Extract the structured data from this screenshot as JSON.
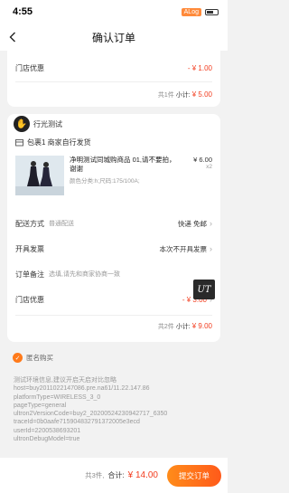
{
  "status": {
    "time": "4:55",
    "badge": "ALog"
  },
  "nav": {
    "title": "确认订单"
  },
  "card1": {
    "discount_label": "门店优惠",
    "discount_value": "- ¥ 1.00",
    "count_text": "共1件",
    "subtotal_label": "小计:",
    "subtotal_value": "¥ 5.00"
  },
  "card2": {
    "shop_name": "行光测试",
    "package_text": "包裹1 商家自行发货",
    "item": {
      "title": "净明测试同城购商品 01,请不要拍，谢谢",
      "sku": "颜色分类:h;尺码:175/100A;",
      "price": "¥ 6.00",
      "qty": "x2"
    },
    "delivery": {
      "label": "配送方式",
      "sub": "普通配送",
      "value": "快递 免邮"
    },
    "invoice": {
      "label": "开具发票",
      "value": "本次不开具发票"
    },
    "note": {
      "label": "订单备注",
      "placeholder": "选填,请先和商家协商一致"
    },
    "discount": {
      "label": "门店优惠",
      "value": "- ¥ 3.00"
    },
    "count_text": "共2件",
    "subtotal_label": "小计:",
    "subtotal_value": "¥ 9.00",
    "ut_badge": "UT"
  },
  "anonymous": {
    "label": "匿名购买",
    "checked": true
  },
  "debug_lines": [
    "测试环境信息,建议开启天启对比忽略",
    "host=buy2011022147086.pre.na61/11.22.147.86",
    "platformType=WIRELESS_3_0",
    "pageType=general",
    "ultron2VersionCode=buy2_20200524230942717_6350",
    "traceId=0b0aafe715904832791372005e3ecd",
    "userId=2200538693201",
    "ultronDebugModel=true"
  ],
  "bottom": {
    "count_text": "共3件,",
    "total_label": "合计:",
    "total_value": "¥ 14.00",
    "submit_label": "提交订单"
  },
  "colors": {
    "accent": "#ff6a1a",
    "price": "#f23c1e"
  }
}
